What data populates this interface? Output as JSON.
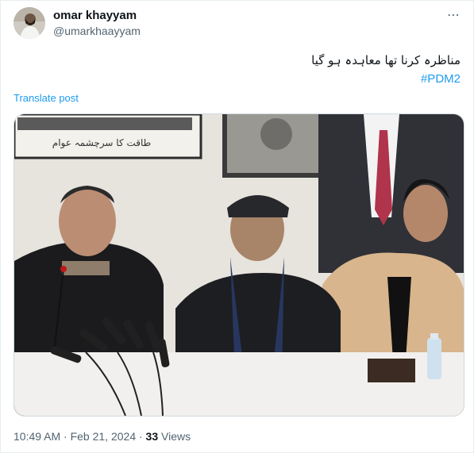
{
  "post": {
    "author_name": "omar khayyam",
    "author_handle": "@umarkhaayyam",
    "text_urdu": "مناظرہ کرنا تھا معاہدہ ہو گیا",
    "hashtag": "#PDM2",
    "translate_label": "Translate post",
    "poster_text_urdu": "طاقت کا سرچشمہ عوام",
    "timestamp": "10:49 AM · Feb 21, 2024 · ",
    "views_count": "33",
    "views_label": " Views",
    "more_icon_glyph": "⋯"
  },
  "colors": {
    "link": "#1d9bf0",
    "secondary_text": "#536471",
    "primary_text": "#0f1419"
  },
  "icons": {
    "more": "more-options-icon",
    "avatar": "avatar"
  }
}
